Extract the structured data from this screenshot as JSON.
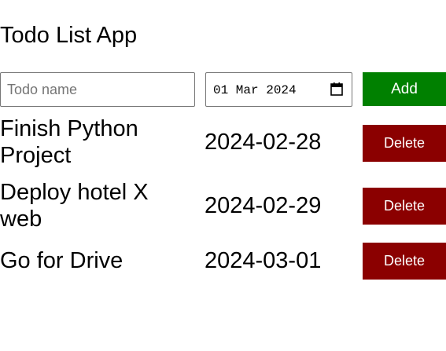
{
  "app": {
    "title": "Todo List App"
  },
  "form": {
    "name_placeholder": "Todo name",
    "name_value": "",
    "date_display": "01 Mar 2024",
    "date_icon": "calendar-icon",
    "add_label": "Add"
  },
  "todos": [
    {
      "name": "Finish Python Project",
      "date": "2024-02-28",
      "delete_label": "Delete"
    },
    {
      "name": "Deploy hotel X web",
      "date": "2024-02-29",
      "delete_label": "Delete"
    },
    {
      "name": "Go for Drive",
      "date": "2024-03-01",
      "delete_label": "Delete"
    }
  ],
  "colors": {
    "add_button": "#008000",
    "delete_button": "#8b0000",
    "button_text": "#ffffff",
    "background": "#ffffff"
  }
}
